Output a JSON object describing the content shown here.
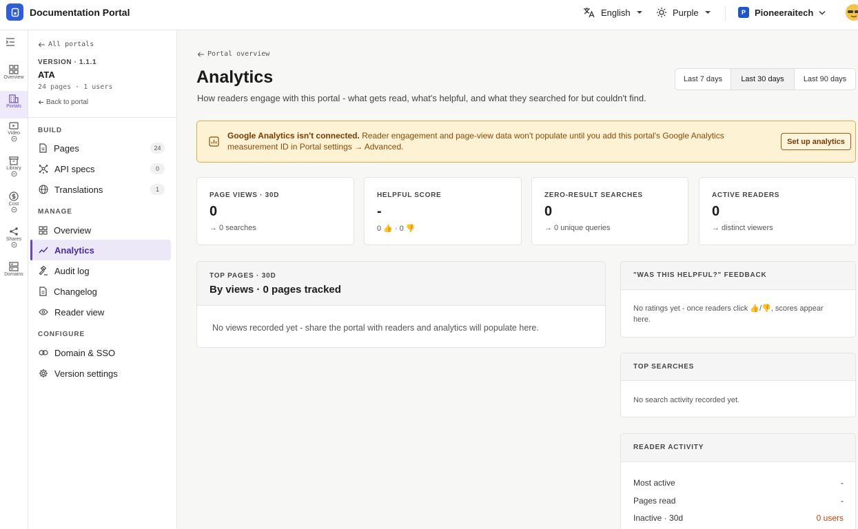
{
  "app": {
    "title": "Documentation Portal"
  },
  "topbar": {
    "language": "English",
    "theme": "Purple",
    "org_initial": "P",
    "org_name": "Pioneeraitech"
  },
  "rail": [
    {
      "label": "Overview"
    },
    {
      "label": "Portals"
    },
    {
      "label": "Video"
    },
    {
      "label": "Library"
    },
    {
      "label": "Cost"
    },
    {
      "label": "Shares"
    },
    {
      "label": "Domains"
    }
  ],
  "sidebar": {
    "back_label": "All portals",
    "version": "VERSION · 1.1.1",
    "portal_name": "ATA",
    "meta": "24 pages · 1 users",
    "back_to_portal": "Back to portal",
    "build_label": "BUILD",
    "manage_label": "MANAGE",
    "configure_label": "CONFIGURE",
    "build": [
      {
        "label": "Pages",
        "count": "24"
      },
      {
        "label": "API specs",
        "count": "0"
      },
      {
        "label": "Translations",
        "count": "1"
      }
    ],
    "manage": [
      {
        "label": "Overview"
      },
      {
        "label": "Analytics"
      },
      {
        "label": "Audit log"
      },
      {
        "label": "Changelog"
      },
      {
        "label": "Reader view"
      }
    ],
    "configure": [
      {
        "label": "Domain & SSO"
      },
      {
        "label": "Version settings"
      }
    ]
  },
  "main": {
    "crumb": "Portal overview",
    "title": "Analytics",
    "subtitle": "How readers engage with this portal - what gets read, what's helpful, and what they searched for but couldn't find.",
    "ranges": [
      "Last 7 days",
      "Last 30 days",
      "Last 90 days"
    ],
    "selected_range": "Last 30 days",
    "alert": {
      "title": "Google Analytics isn't connected.",
      "body": " Reader engagement and page-view data won't populate until you add this portal's Google Analytics measurement ID in Portal settings → Advanced.",
      "button": "Set up analytics"
    },
    "stats": [
      {
        "label": "PAGE VIEWS · 30D",
        "value": "0",
        "note": "→ 0 searches"
      },
      {
        "label": "HELPFUL SCORE",
        "value": "-",
        "note": "0 👍 · 0 👎"
      },
      {
        "label": "ZERO-RESULT SEARCHES",
        "value": "0",
        "note": "→ 0 unique queries"
      },
      {
        "label": "ACTIVE READERS",
        "value": "0",
        "note": "→ distinct viewers"
      }
    ],
    "top_pages": {
      "kicker": "TOP PAGES · 30D",
      "title": "By views · 0 pages tracked",
      "empty": "No views recorded yet - share the portal with readers and analytics will populate here."
    },
    "feedback": {
      "kicker": "\"WAS THIS HELPFUL?\" FEEDBACK",
      "empty": "No ratings yet - once readers click 👍/👎, scores appear here."
    },
    "searches": {
      "kicker": "TOP SEARCHES",
      "empty": "No search activity recorded yet."
    },
    "reader_activity": {
      "kicker": "READER ACTIVITY",
      "rows": [
        {
          "label": "Most active",
          "value": "-"
        },
        {
          "label": "Pages read",
          "value": "-"
        },
        {
          "label": "Inactive · 30d",
          "value": "0 users"
        }
      ]
    }
  },
  "colors": {
    "accent": "#6b46c1",
    "brand": "#2f5ed8",
    "warning_bg": "#fdf2d3",
    "warning_text": "#8a4a05",
    "inactive_value": "#c2410c"
  }
}
